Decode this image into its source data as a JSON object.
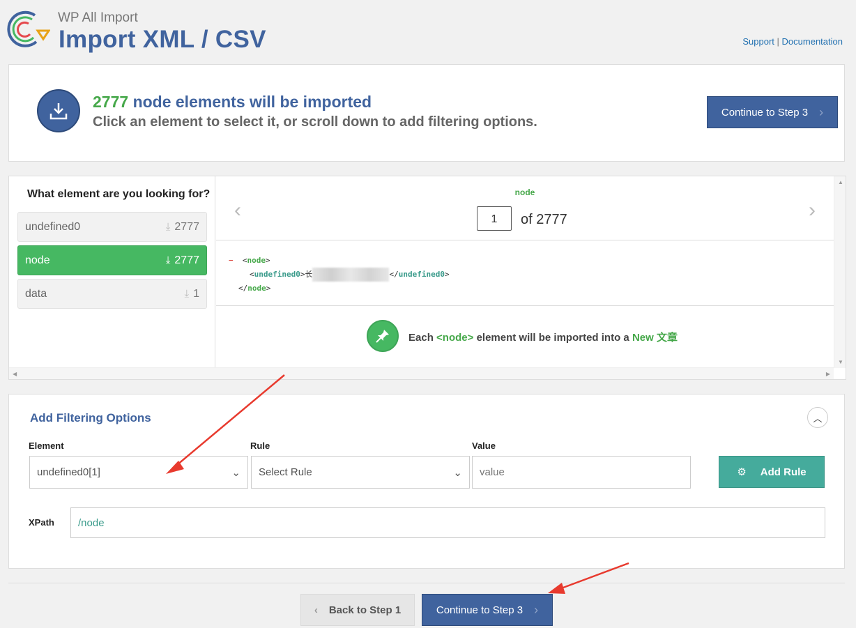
{
  "header": {
    "brand": "WP All Import",
    "title": "Import XML / CSV",
    "support_label": "Support",
    "separator": "|",
    "docs_label": "Documentation"
  },
  "summary": {
    "count": "2777",
    "count_text": "node elements will be imported",
    "subtitle": "Click an element to select it, or scroll down to add filtering options.",
    "continue_label": "Continue to Step 3"
  },
  "elements": {
    "question": "What element are you looking for?",
    "items": [
      {
        "label": "undefined0",
        "count": "2777"
      },
      {
        "label": "node",
        "count": "2777"
      },
      {
        "label": "data",
        "count": "1"
      }
    ]
  },
  "preview": {
    "node_label": "node",
    "page": "1",
    "of_text": "of 2777",
    "xml_minus": "−",
    "xml_open": "node",
    "xml_child": "undefined0",
    "xml_value_start": "长",
    "xml_close": "node",
    "import_prefix": "Each",
    "import_tag": "<node>",
    "import_mid": "element will be imported into a",
    "import_target": "New 文章"
  },
  "filter": {
    "title": "Add Filtering Options",
    "element_label": "Element",
    "element_value": "undefined0[1]",
    "rule_label": "Rule",
    "rule_value": "Select Rule",
    "value_label": "Value",
    "value_placeholder": "value",
    "add_rule_label": "Add Rule",
    "xpath_label": "XPath",
    "xpath_value": "/node"
  },
  "footer": {
    "back_label": "Back to Step 1",
    "continue_label": "Continue to Step 3"
  },
  "colors": {
    "accent_blue": "#40639e",
    "green": "#46b862",
    "teal": "#45ab9c",
    "annotation_red": "#e83a2e"
  }
}
